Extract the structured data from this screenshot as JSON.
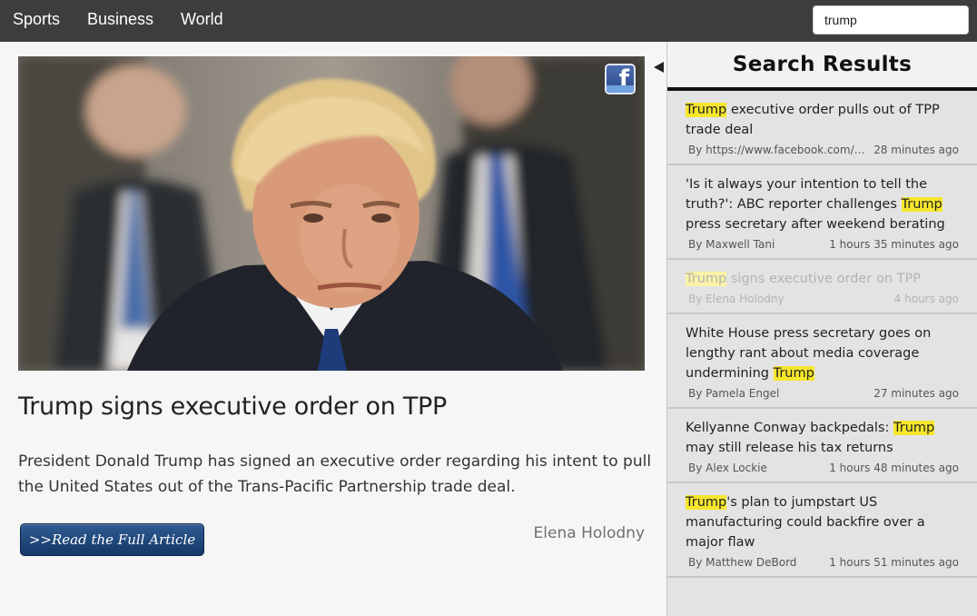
{
  "nav": {
    "links": [
      "Sports",
      "Business",
      "World"
    ],
    "search_value": "trump"
  },
  "article": {
    "title": "Trump signs executive order on TPP",
    "summary": "President Donald Trump has signed an executive order regarding his intent to pull the United States out of the Trans-Pacific Partnership trade deal.",
    "read_more_label": ">>Read the Full Article",
    "author": "Elena Holodny",
    "share_icon": "facebook-icon",
    "share_letter": "f"
  },
  "sidebar": {
    "title": "Search Results",
    "highlight_color": "#f6e62c",
    "results": [
      {
        "pre": "",
        "hl": "Trump",
        "post": " executive order pulls out of TPP trade deal",
        "author": "By https://www.facebook.com/bb...",
        "time": "28 minutes ago",
        "active": false
      },
      {
        "pre": "'Is it always your intention to tell the truth?': ABC reporter challenges ",
        "hl": "Trump",
        "post": " press secretary after weekend berating",
        "author": "By Maxwell Tani",
        "time": "1 hours 35 minutes ago",
        "active": false
      },
      {
        "pre": "",
        "hl": "Trump",
        "post": " signs executive order on TPP",
        "author": "By Elena Holodny",
        "time": "4 hours ago",
        "active": true
      },
      {
        "pre": "White House press secretary goes on lengthy rant about media coverage undermining ",
        "hl": "Trump",
        "post": "",
        "author": "By Pamela Engel",
        "time": "27 minutes ago",
        "active": false
      },
      {
        "pre": "Kellyanne Conway backpedals: ",
        "hl": "Trump",
        "post": " may still release his tax returns",
        "author": "By Alex Lockie",
        "time": "1 hours 48 minutes ago",
        "active": false
      },
      {
        "pre": "",
        "hl": "Trump",
        "post": "'s plan to jumpstart US manufacturing could backfire over a major flaw",
        "author": "By Matthew DeBord",
        "time": "1 hours 51 minutes ago",
        "active": false
      }
    ]
  }
}
